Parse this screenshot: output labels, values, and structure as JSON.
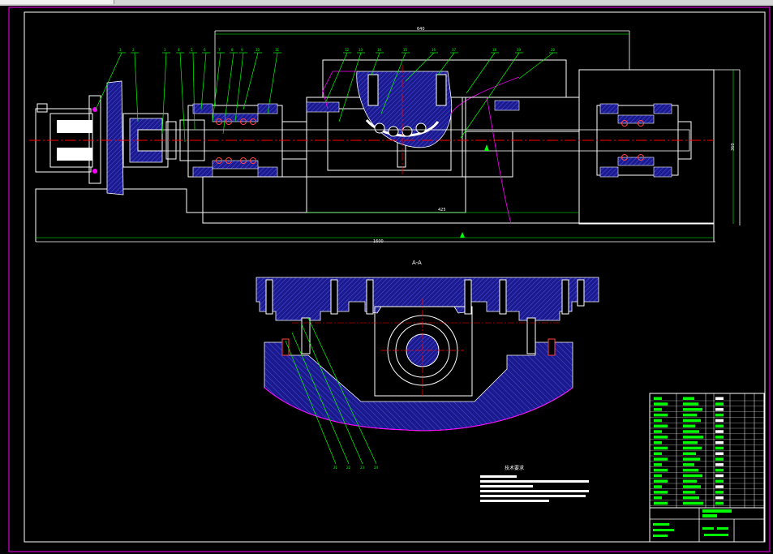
{
  "drawing": {
    "colors": {
      "frame": "#ff00ff",
      "section": "#1a1a8c",
      "hatch": "#3b3bd0",
      "outline": "#ffffff",
      "center": "#ff0000",
      "leader": "#00ff00",
      "dim": "#00ff00",
      "note": "#ffffff",
      "title_fill": "#00ff00"
    },
    "balloons_top": [
      "1",
      "2",
      "3",
      "4",
      "5",
      "6",
      "7",
      "8",
      "9",
      "10",
      "11",
      "12",
      "13",
      "14",
      "15",
      "16",
      "17",
      "18",
      "19",
      "20"
    ],
    "balloons_bottom": [
      "21",
      "22",
      "23",
      "24"
    ],
    "section_label": "A-A",
    "dim_overall": "1600",
    "dim_top": "640",
    "dim_mid": "425",
    "dim_height": "360",
    "notes_title": "技术要求",
    "title_block": {
      "drawing_title": "机床夹具装配图",
      "sub_title": "装配图"
    }
  }
}
